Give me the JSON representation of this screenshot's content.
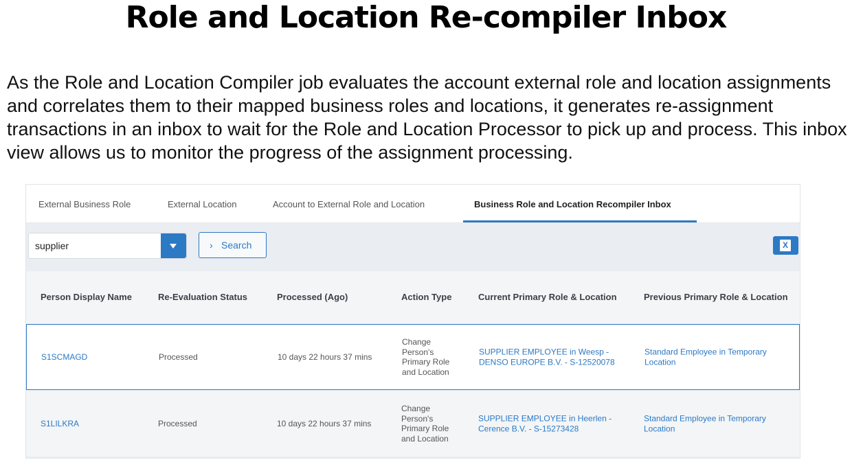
{
  "slide": {
    "title": "Role and Location Re-compiler Inbox",
    "description": "As the Role and Location Compiler job evaluates the account external role and location assignments and correlates them to their mapped business roles and locations, it generates re-assignment transactions in an inbox to wait for the Role and Location Processor to pick up and process.  This inbox view allows us to monitor the progress of the assignment processing."
  },
  "tabs": [
    {
      "label": "External Business Role",
      "active": false
    },
    {
      "label": "External Location",
      "active": false
    },
    {
      "label": "Account to External Role and Location",
      "active": false
    },
    {
      "label": "Business Role and Location Recompiler Inbox",
      "active": true
    }
  ],
  "toolbar": {
    "filter_value": "supplier",
    "search_label": "Search",
    "dropdown_icon": "caret-down-icon",
    "export_icon": "excel-export-icon"
  },
  "table": {
    "columns": [
      "Person Display Name",
      "Re-Evaluation Status",
      "Processed (Ago)",
      "Action Type",
      "Current Primary Role & Location",
      "Previous Primary Role & Location"
    ],
    "rows": [
      {
        "person": "S1SCMAGD",
        "status": "Processed",
        "processed_ago": "10 days 22 hours 37 mins",
        "action_type": [
          "Change",
          "Person's",
          "Primary Role",
          "and Location"
        ],
        "current": [
          "SUPPLIER EMPLOYEE in Weesp -",
          "DENSO EUROPE B.V. - S-12520078"
        ],
        "previous": [
          "Standard Employee in Temporary",
          "Location"
        ]
      },
      {
        "person": "S1LILKRA",
        "status": "Processed",
        "processed_ago": "10 days 22 hours 37 mins",
        "action_type": [
          "Change",
          "Person's",
          "Primary Role",
          "and Location"
        ],
        "current": [
          "SUPPLIER EMPLOYEE in Heerlen -",
          "Cerence B.V. - S-15273428"
        ],
        "previous": [
          "Standard Employee in Temporary",
          "Location"
        ]
      }
    ]
  },
  "colors": {
    "accent": "#2c79c4",
    "panel_bg": "#eaedf2",
    "header_bg": "#f3f5f7"
  }
}
